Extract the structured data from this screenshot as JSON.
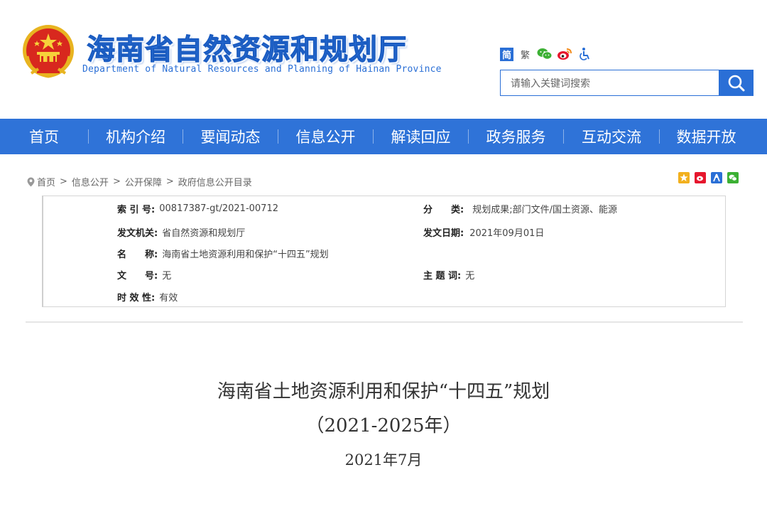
{
  "header": {
    "site_title": "海南省自然资源和规划厅",
    "site_subtitle": "Department of Natural Resources and Planning of Hainan Province",
    "lang_simplified": "简",
    "lang_traditional": "繁",
    "search_placeholder": "请输入关键词搜索",
    "icons": [
      "national-emblem-icon",
      "wechat-icon",
      "weibo-icon",
      "accessibility-icon",
      "search-icon"
    ]
  },
  "nav": {
    "items": [
      {
        "label": "首页"
      },
      {
        "label": "机构介绍"
      },
      {
        "label": "要闻动态"
      },
      {
        "label": "信息公开"
      },
      {
        "label": "解读回应"
      },
      {
        "label": "政务服务"
      },
      {
        "label": "互动交流"
      },
      {
        "label": "数据开放"
      }
    ]
  },
  "breadcrumb": {
    "items": [
      "首页",
      "信息公开",
      "公开保障",
      "政府信息公开目录"
    ],
    "separator": ">"
  },
  "share_icons": [
    "qzone-share-icon",
    "weibo-share-icon",
    "renren-share-icon",
    "wechat-share-icon"
  ],
  "info": {
    "index_label": "索 引 号:",
    "index_value": "00817387-gt/2021-00712",
    "category_label": "分　　类:",
    "category_value": "规划成果;部门文件/国土资源、能源",
    "issuer_label": "发文机关:",
    "issuer_value": "省自然资源和规划厅",
    "date_label": "发文日期:",
    "date_value": "2021年09月01日",
    "name_label": "名　　称:",
    "name_value": "海南省土地资源利用和保护“十四五”规划",
    "docno_label": "文　　号:",
    "docno_value": "无",
    "keywords_label": "主 题 词:",
    "keywords_value": "无",
    "validity_label": "时 效 性:",
    "validity_value": "有效"
  },
  "article": {
    "title_line1": "海南省土地资源利用和保护“十四五”规划",
    "title_line2": "（2021-2025年）",
    "date": "2021年7月"
  },
  "colors": {
    "brand_blue": "#2f73d8",
    "title_blue": "#2a6fd6"
  }
}
